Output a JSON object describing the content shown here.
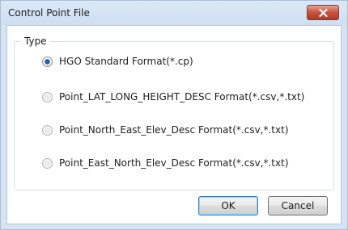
{
  "window": {
    "title": "Control Point File"
  },
  "group": {
    "label": "Type",
    "options": [
      {
        "label": "HGO Standard Format(*.cp)",
        "selected": true
      },
      {
        "label": "Point_LAT_LONG_HEIGHT_DESC Format(*.csv,*.txt)",
        "selected": false
      },
      {
        "label": "Point_North_East_Elev_Desc Format(*.csv,*.txt)",
        "selected": false
      },
      {
        "label": "Point_East_North_Elev_Desc Format(*.csv,*.txt)",
        "selected": false
      }
    ]
  },
  "buttons": {
    "ok": "OK",
    "cancel": "Cancel"
  },
  "colors": {
    "title_bar": "#d6e3f2",
    "close_button": "#c8523c",
    "radio_selected_dot": "#1f5fa8"
  },
  "icons": {
    "close": "close-icon",
    "radio_selected": "radio-selected-icon",
    "radio_unselected": "radio-unselected-icon"
  }
}
